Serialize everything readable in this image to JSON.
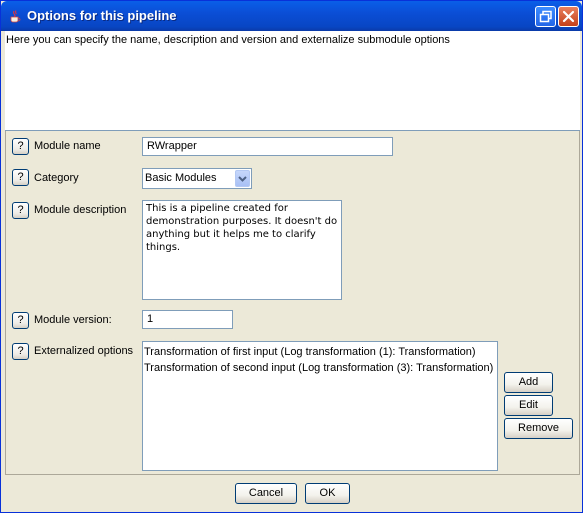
{
  "window": {
    "title": "Options for this pipeline",
    "icon": "java-cup-icon"
  },
  "description_text": "Here you can specify the name, description and version and externalize submodule options",
  "form": {
    "help_label": "?",
    "module_name": {
      "label": "Module name",
      "value": "RWrapper"
    },
    "category": {
      "label": "Category",
      "selected": "Basic Modules"
    },
    "module_description": {
      "label": "Module description",
      "lines": [
        "This is a pipeline created for",
        "demonstration purposes. It doesn't do",
        "anything but it helps me to clarify things."
      ]
    },
    "module_version": {
      "label": "Module version:",
      "value": "1"
    },
    "externalized_options": {
      "label": "Externalized options",
      "items": [
        "Transformation of first input  (Log transformation (1): Transformation)",
        "Transformation of second input  (Log transformation (3): Transformation)"
      ],
      "add_label": "Add",
      "edit_label": "Edit",
      "remove_label": "Remove"
    }
  },
  "footer": {
    "cancel_label": "Cancel",
    "ok_label": "OK"
  }
}
